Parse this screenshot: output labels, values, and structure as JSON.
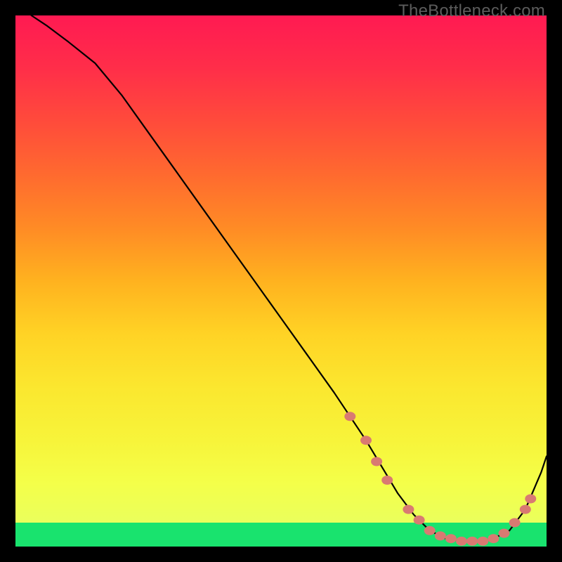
{
  "watermark": "TheBottleneck.com",
  "chart_data": {
    "type": "line",
    "title": "",
    "xlabel": "",
    "ylabel": "",
    "xlim": [
      0,
      100
    ],
    "ylim": [
      0,
      100
    ],
    "grid": false,
    "legend": false,
    "series": [
      {
        "name": "bottleneck-curve",
        "color": "#000000",
        "x": [
          3,
          6,
          10,
          15,
          20,
          25,
          30,
          35,
          40,
          45,
          50,
          55,
          60,
          63,
          66,
          69,
          72,
          75,
          78,
          81,
          84,
          87,
          90,
          93,
          96,
          99,
          100
        ],
        "y": [
          100,
          98,
          95,
          91,
          85,
          78,
          71,
          64,
          57,
          50,
          43,
          36,
          29,
          24.5,
          20,
          15,
          10,
          6,
          3,
          1.5,
          1,
          1,
          1.5,
          3,
          7,
          14,
          17
        ]
      }
    ],
    "markers": {
      "name": "highlight-dots",
      "color": "#d97a72",
      "points": [
        {
          "x": 63,
          "y": 24.5
        },
        {
          "x": 66,
          "y": 20
        },
        {
          "x": 68,
          "y": 16
        },
        {
          "x": 70,
          "y": 12.5
        },
        {
          "x": 74,
          "y": 7
        },
        {
          "x": 76,
          "y": 5
        },
        {
          "x": 78,
          "y": 3
        },
        {
          "x": 80,
          "y": 2
        },
        {
          "x": 82,
          "y": 1.5
        },
        {
          "x": 84,
          "y": 1
        },
        {
          "x": 86,
          "y": 1
        },
        {
          "x": 88,
          "y": 1
        },
        {
          "x": 90,
          "y": 1.5
        },
        {
          "x": 92,
          "y": 2.5
        },
        {
          "x": 94,
          "y": 4.5
        },
        {
          "x": 96,
          "y": 7
        },
        {
          "x": 97,
          "y": 9
        }
      ]
    },
    "background": {
      "type": "vertical-gradient-with-bottom-band",
      "stops": [
        {
          "pos": 0.0,
          "color": "#ff1a52"
        },
        {
          "pos": 0.1,
          "color": "#ff2e49"
        },
        {
          "pos": 0.2,
          "color": "#ff4b3b"
        },
        {
          "pos": 0.3,
          "color": "#ff6a2f"
        },
        {
          "pos": 0.4,
          "color": "#ff8b25"
        },
        {
          "pos": 0.5,
          "color": "#ffb21f"
        },
        {
          "pos": 0.6,
          "color": "#ffd325"
        },
        {
          "pos": 0.7,
          "color": "#fbe72f"
        },
        {
          "pos": 0.8,
          "color": "#f7f43a"
        },
        {
          "pos": 0.88,
          "color": "#f4ff49"
        },
        {
          "pos": 0.955,
          "color": "#eaff5c"
        }
      ],
      "bottom_band": {
        "from": 0.955,
        "to": 1.0,
        "color": "#19e36e"
      }
    }
  }
}
